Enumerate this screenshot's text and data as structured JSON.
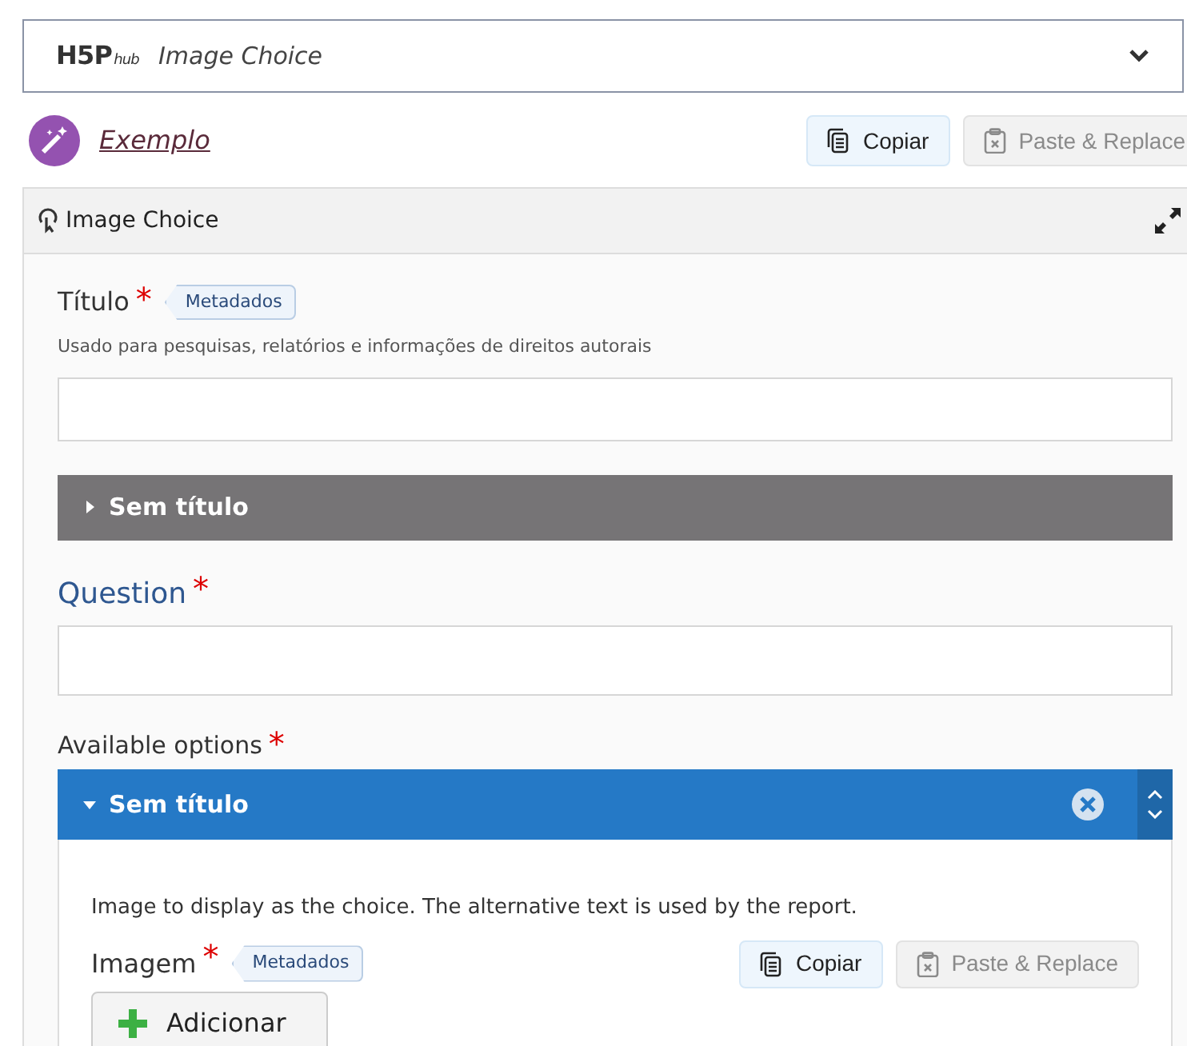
{
  "hub": {
    "logo": "H5P",
    "logo_sub": "hub",
    "title": "Image Choice",
    "expanded": false
  },
  "example": {
    "label": "Exemplo"
  },
  "top_buttons": [
    {
      "label": "Copiar",
      "disabled": false
    },
    {
      "label": "Paste & Replace",
      "disabled": true
    }
  ],
  "editor": {
    "title": "Image Choice",
    "title_field": {
      "label": "Título",
      "required_mark": "*",
      "badge": "Metadados",
      "description": "Usado para pesquisas, relatórios e informações de direitos autorais"
    },
    "group": {
      "label": "Sem título",
      "expanded": false
    },
    "question": {
      "label": "Question",
      "required_mark": "*"
    },
    "options": {
      "label": "Available options",
      "required_mark": "*",
      "items": [
        {
          "label": "Sem título",
          "expanded": true,
          "description": "Image to display as the choice. The alternative text is used by the report.",
          "image_label": "Imagem",
          "required_mark": "*",
          "badge": "Metadados",
          "buttons": [
            {
              "label": "Copiar",
              "disabled": false
            },
            {
              "label": "Paste & Replace",
              "disabled": true
            }
          ],
          "add_button": "Adicionar"
        }
      ]
    }
  }
}
